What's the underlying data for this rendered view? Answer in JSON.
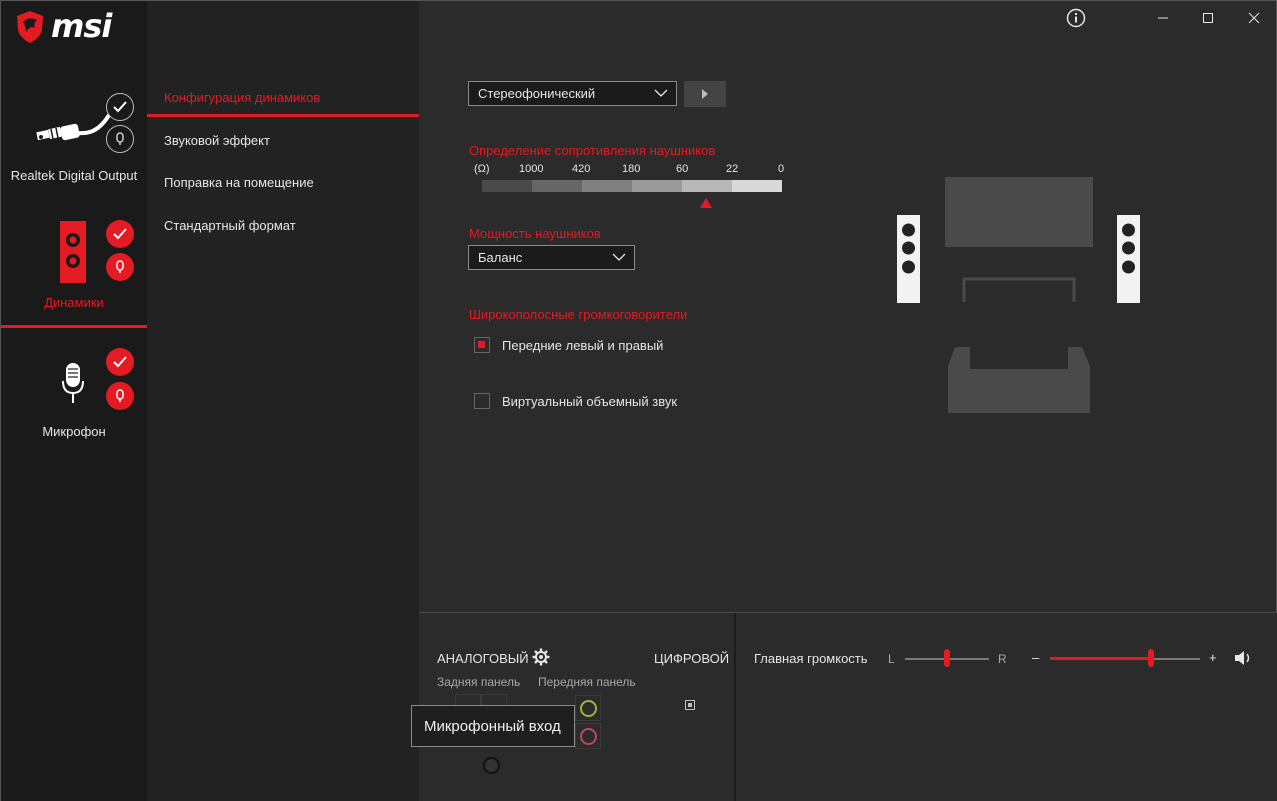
{
  "app": {
    "logo_text": "msi"
  },
  "devices": [
    {
      "label": "Realtek Digital Output"
    },
    {
      "label": "Динамики"
    },
    {
      "label": "Микрофон"
    }
  ],
  "nav": {
    "items": [
      {
        "label": "Конфигурация динамиков"
      },
      {
        "label": "Звуковой эффект"
      },
      {
        "label": "Поправка на помещение"
      },
      {
        "label": "Стандартный формат"
      }
    ]
  },
  "config": {
    "speaker_mode": "Стереофонический",
    "impedance_title": "Определение сопротивления наушников",
    "impedance_ticks": [
      "(Ω)",
      "1000",
      "420",
      "180",
      "60",
      "22",
      "0"
    ],
    "impedance_selected_index": 4,
    "power_title": "Мощность наушников",
    "power_value": "Баланс",
    "fullrange_title": "Широкополосные громкоговорители",
    "front_lr_label": "Передние левый и правый",
    "front_lr_checked": true,
    "virtual_surround_label": "Виртуальный объемный звук",
    "virtual_surround_checked": false
  },
  "bottom": {
    "analog_label": "АНАЛОГОВЫЙ",
    "digital_label": "ЦИФРОВОЙ",
    "rear_panel_label": "Задняя панель",
    "front_panel_label": "Передняя панель",
    "tooltip": "Микрофонный вход",
    "volume_label": "Главная громкость",
    "balance_left": "L",
    "balance_right": "R",
    "minus": "–",
    "plus": "+",
    "balance_value": 0.5,
    "volume_value": 0.67
  },
  "colors": {
    "accent": "#e41b23",
    "jack_green": "#9bb53a",
    "jack_pink": "#c2435f"
  }
}
